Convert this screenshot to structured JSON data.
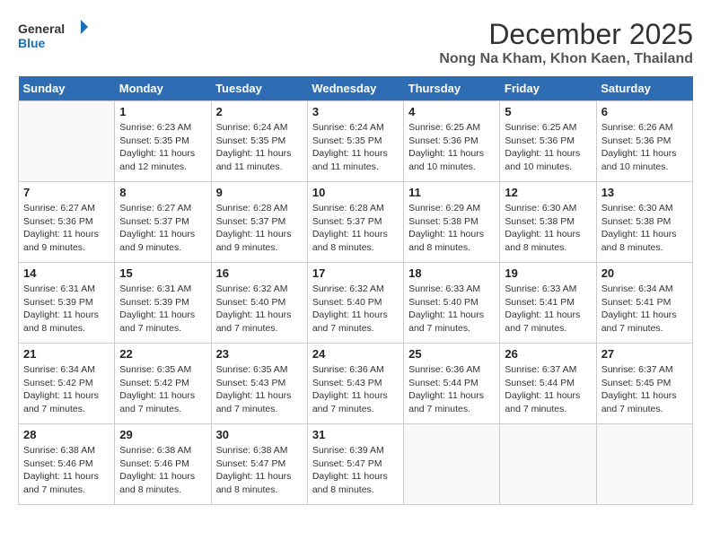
{
  "header": {
    "logo_general": "General",
    "logo_blue": "Blue",
    "month_title": "December 2025",
    "location": "Nong Na Kham, Khon Kaen, Thailand"
  },
  "days_of_week": [
    "Sunday",
    "Monday",
    "Tuesday",
    "Wednesday",
    "Thursday",
    "Friday",
    "Saturday"
  ],
  "weeks": [
    [
      {
        "day": "",
        "sunrise": "",
        "sunset": "",
        "daylight": "",
        "empty": true
      },
      {
        "day": "1",
        "sunrise": "Sunrise: 6:23 AM",
        "sunset": "Sunset: 5:35 PM",
        "daylight": "Daylight: 11 hours and 12 minutes."
      },
      {
        "day": "2",
        "sunrise": "Sunrise: 6:24 AM",
        "sunset": "Sunset: 5:35 PM",
        "daylight": "Daylight: 11 hours and 11 minutes."
      },
      {
        "day": "3",
        "sunrise": "Sunrise: 6:24 AM",
        "sunset": "Sunset: 5:35 PM",
        "daylight": "Daylight: 11 hours and 11 minutes."
      },
      {
        "day": "4",
        "sunrise": "Sunrise: 6:25 AM",
        "sunset": "Sunset: 5:36 PM",
        "daylight": "Daylight: 11 hours and 10 minutes."
      },
      {
        "day": "5",
        "sunrise": "Sunrise: 6:25 AM",
        "sunset": "Sunset: 5:36 PM",
        "daylight": "Daylight: 11 hours and 10 minutes."
      },
      {
        "day": "6",
        "sunrise": "Sunrise: 6:26 AM",
        "sunset": "Sunset: 5:36 PM",
        "daylight": "Daylight: 11 hours and 10 minutes."
      }
    ],
    [
      {
        "day": "7",
        "sunrise": "Sunrise: 6:27 AM",
        "sunset": "Sunset: 5:36 PM",
        "daylight": "Daylight: 11 hours and 9 minutes."
      },
      {
        "day": "8",
        "sunrise": "Sunrise: 6:27 AM",
        "sunset": "Sunset: 5:37 PM",
        "daylight": "Daylight: 11 hours and 9 minutes."
      },
      {
        "day": "9",
        "sunrise": "Sunrise: 6:28 AM",
        "sunset": "Sunset: 5:37 PM",
        "daylight": "Daylight: 11 hours and 9 minutes."
      },
      {
        "day": "10",
        "sunrise": "Sunrise: 6:28 AM",
        "sunset": "Sunset: 5:37 PM",
        "daylight": "Daylight: 11 hours and 8 minutes."
      },
      {
        "day": "11",
        "sunrise": "Sunrise: 6:29 AM",
        "sunset": "Sunset: 5:38 PM",
        "daylight": "Daylight: 11 hours and 8 minutes."
      },
      {
        "day": "12",
        "sunrise": "Sunrise: 6:30 AM",
        "sunset": "Sunset: 5:38 PM",
        "daylight": "Daylight: 11 hours and 8 minutes."
      },
      {
        "day": "13",
        "sunrise": "Sunrise: 6:30 AM",
        "sunset": "Sunset: 5:38 PM",
        "daylight": "Daylight: 11 hours and 8 minutes."
      }
    ],
    [
      {
        "day": "14",
        "sunrise": "Sunrise: 6:31 AM",
        "sunset": "Sunset: 5:39 PM",
        "daylight": "Daylight: 11 hours and 8 minutes."
      },
      {
        "day": "15",
        "sunrise": "Sunrise: 6:31 AM",
        "sunset": "Sunset: 5:39 PM",
        "daylight": "Daylight: 11 hours and 7 minutes."
      },
      {
        "day": "16",
        "sunrise": "Sunrise: 6:32 AM",
        "sunset": "Sunset: 5:40 PM",
        "daylight": "Daylight: 11 hours and 7 minutes."
      },
      {
        "day": "17",
        "sunrise": "Sunrise: 6:32 AM",
        "sunset": "Sunset: 5:40 PM",
        "daylight": "Daylight: 11 hours and 7 minutes."
      },
      {
        "day": "18",
        "sunrise": "Sunrise: 6:33 AM",
        "sunset": "Sunset: 5:40 PM",
        "daylight": "Daylight: 11 hours and 7 minutes."
      },
      {
        "day": "19",
        "sunrise": "Sunrise: 6:33 AM",
        "sunset": "Sunset: 5:41 PM",
        "daylight": "Daylight: 11 hours and 7 minutes."
      },
      {
        "day": "20",
        "sunrise": "Sunrise: 6:34 AM",
        "sunset": "Sunset: 5:41 PM",
        "daylight": "Daylight: 11 hours and 7 minutes."
      }
    ],
    [
      {
        "day": "21",
        "sunrise": "Sunrise: 6:34 AM",
        "sunset": "Sunset: 5:42 PM",
        "daylight": "Daylight: 11 hours and 7 minutes."
      },
      {
        "day": "22",
        "sunrise": "Sunrise: 6:35 AM",
        "sunset": "Sunset: 5:42 PM",
        "daylight": "Daylight: 11 hours and 7 minutes."
      },
      {
        "day": "23",
        "sunrise": "Sunrise: 6:35 AM",
        "sunset": "Sunset: 5:43 PM",
        "daylight": "Daylight: 11 hours and 7 minutes."
      },
      {
        "day": "24",
        "sunrise": "Sunrise: 6:36 AM",
        "sunset": "Sunset: 5:43 PM",
        "daylight": "Daylight: 11 hours and 7 minutes."
      },
      {
        "day": "25",
        "sunrise": "Sunrise: 6:36 AM",
        "sunset": "Sunset: 5:44 PM",
        "daylight": "Daylight: 11 hours and 7 minutes."
      },
      {
        "day": "26",
        "sunrise": "Sunrise: 6:37 AM",
        "sunset": "Sunset: 5:44 PM",
        "daylight": "Daylight: 11 hours and 7 minutes."
      },
      {
        "day": "27",
        "sunrise": "Sunrise: 6:37 AM",
        "sunset": "Sunset: 5:45 PM",
        "daylight": "Daylight: 11 hours and 7 minutes."
      }
    ],
    [
      {
        "day": "28",
        "sunrise": "Sunrise: 6:38 AM",
        "sunset": "Sunset: 5:46 PM",
        "daylight": "Daylight: 11 hours and 7 minutes."
      },
      {
        "day": "29",
        "sunrise": "Sunrise: 6:38 AM",
        "sunset": "Sunset: 5:46 PM",
        "daylight": "Daylight: 11 hours and 8 minutes."
      },
      {
        "day": "30",
        "sunrise": "Sunrise: 6:38 AM",
        "sunset": "Sunset: 5:47 PM",
        "daylight": "Daylight: 11 hours and 8 minutes."
      },
      {
        "day": "31",
        "sunrise": "Sunrise: 6:39 AM",
        "sunset": "Sunset: 5:47 PM",
        "daylight": "Daylight: 11 hours and 8 minutes."
      },
      {
        "day": "",
        "sunrise": "",
        "sunset": "",
        "daylight": "",
        "empty": true
      },
      {
        "day": "",
        "sunrise": "",
        "sunset": "",
        "daylight": "",
        "empty": true
      },
      {
        "day": "",
        "sunrise": "",
        "sunset": "",
        "daylight": "",
        "empty": true
      }
    ]
  ]
}
